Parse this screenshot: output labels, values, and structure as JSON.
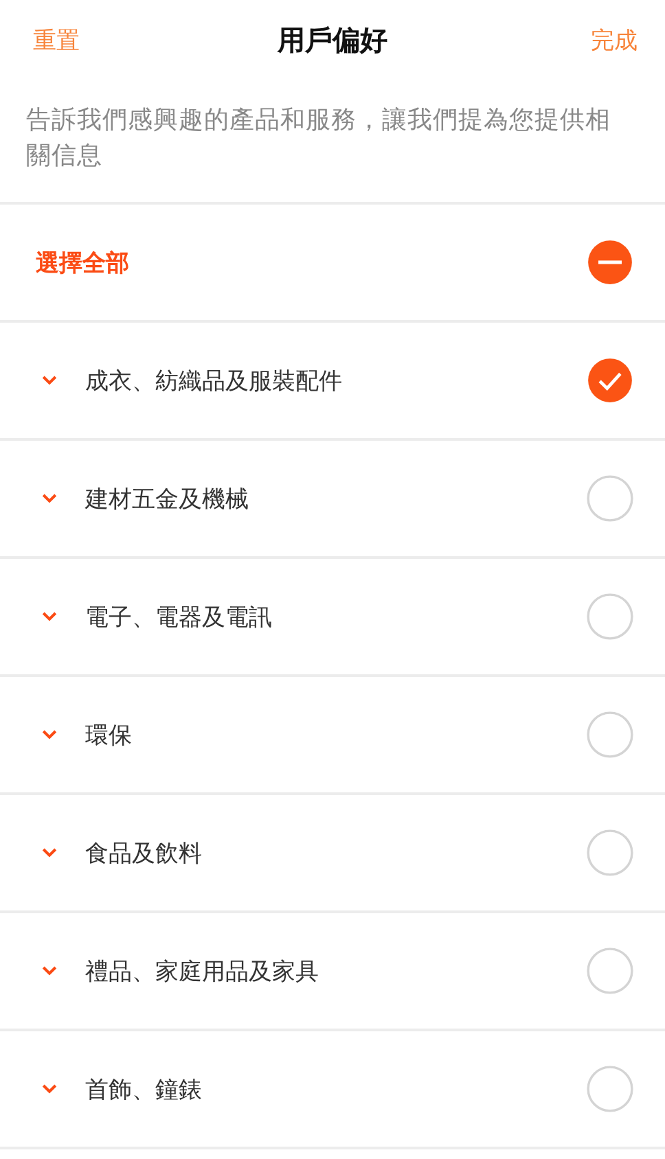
{
  "header": {
    "left_action": "重置",
    "title": "用戶偏好",
    "right_action": "完成"
  },
  "description": "告訴我們感興趣的產品和服務，讓我們提為您提供相關信息",
  "select_all": {
    "label": "選擇全部",
    "indeterminate": true
  },
  "categories": [
    {
      "label": "成衣、紡織品及服裝配件",
      "checked": true,
      "expanded": false
    },
    {
      "label": "建材五金及機械",
      "checked": false,
      "expanded": false
    },
    {
      "label": "電子、電器及電訊",
      "checked": false,
      "expanded": false
    },
    {
      "label": "環保",
      "checked": false,
      "expanded": false
    },
    {
      "label": "食品及飲料",
      "checked": false,
      "expanded": false
    },
    {
      "label": "禮品、家庭用品及家具",
      "checked": false,
      "expanded": false
    },
    {
      "label": "首飾、鐘錶",
      "checked": false,
      "expanded": false
    }
  ]
}
